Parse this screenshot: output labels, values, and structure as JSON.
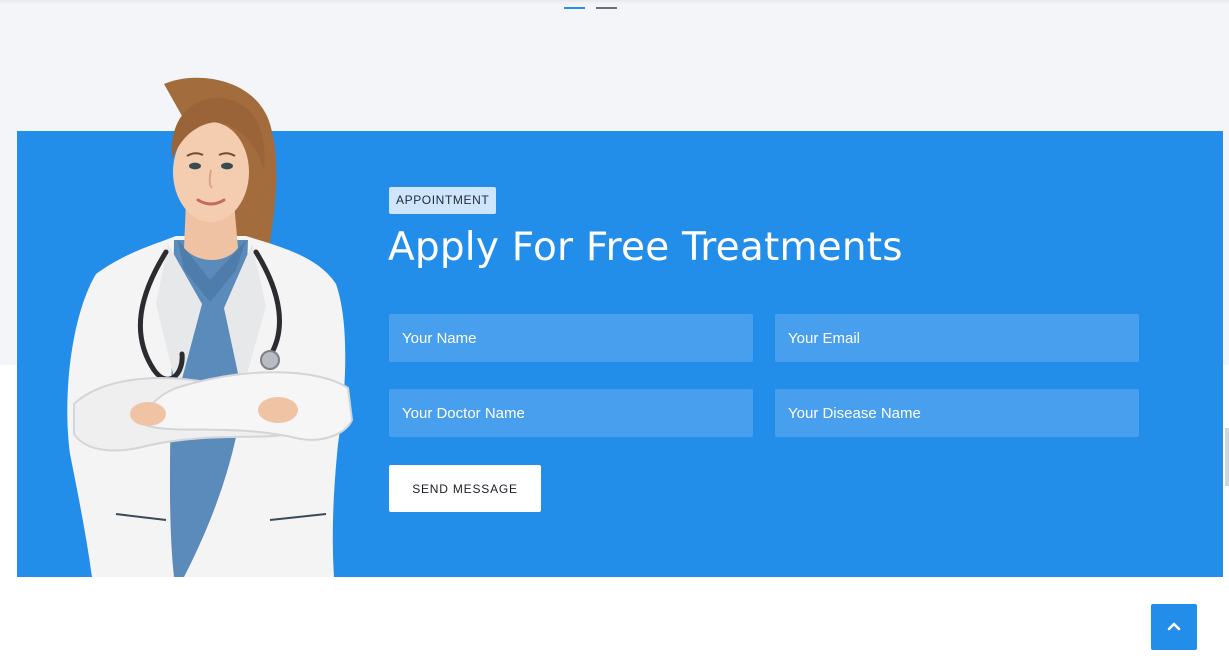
{
  "slider": {
    "dots": [
      {
        "name": "slide-1",
        "active": true
      },
      {
        "name": "slide-2",
        "active": false
      }
    ]
  },
  "appointment": {
    "badge": "APPOINTMENT",
    "title": "Apply For Free Treatments",
    "fields": {
      "name_placeholder": "Your Name",
      "email_placeholder": "Your Email",
      "doctor_placeholder": "Your Doctor Name",
      "disease_placeholder": "Your Disease Name"
    },
    "submit_label": "SEND MESSAGE"
  },
  "back_to_top": {
    "icon": "chevron-up-icon"
  },
  "colors": {
    "accent": "#238eea",
    "field_bg": "#479fee",
    "badge_bg": "#cfe5fb",
    "page_band": "#f4f5f9"
  }
}
